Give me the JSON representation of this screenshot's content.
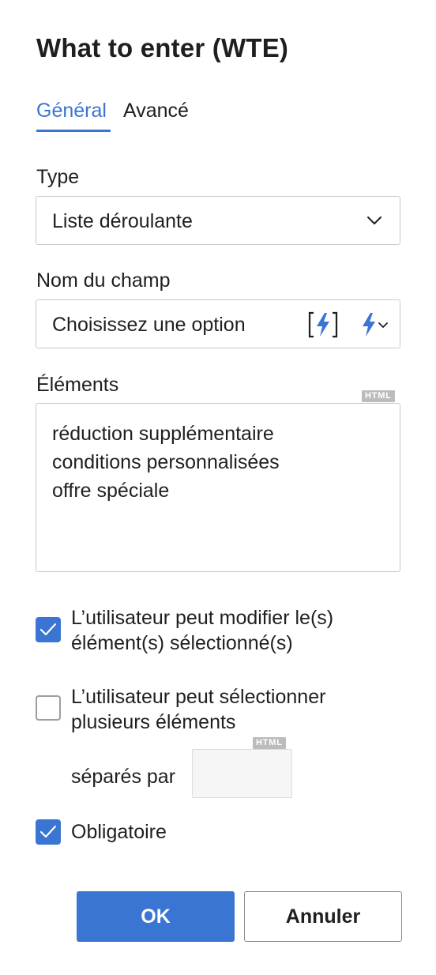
{
  "dialog": {
    "title": "What to enter (WTE)"
  },
  "tabs": [
    {
      "label": "Général",
      "active": true
    },
    {
      "label": "Avancé",
      "active": false
    }
  ],
  "type_field": {
    "label": "Type",
    "value": "Liste déroulante"
  },
  "field_name": {
    "label": "Nom du champ",
    "value": "Choisissez une option"
  },
  "elements": {
    "label": "Éléments",
    "badge": "HTML",
    "lines": [
      "réduction supplémentaire",
      "conditions personnalisées",
      "offre spéciale"
    ]
  },
  "options": {
    "can_edit": {
      "label_line1": "L’utilisateur peut modifier le(s)",
      "label_line2": "élément(s) sélectionné(s)",
      "checked": true
    },
    "multi_select": {
      "label_line1": "L’utilisateur peut sélectionner",
      "label_line2": "plusieurs éléments",
      "checked": false
    },
    "separator": {
      "label": "séparés par",
      "value": "",
      "badge": "HTML"
    },
    "required": {
      "label": "Obligatoire",
      "checked": true
    }
  },
  "buttons": {
    "ok": "OK",
    "cancel": "Annuler"
  },
  "colors": {
    "accent": "#3a75d4",
    "border": "#c9c9c9",
    "badge": "#bcbcbc"
  },
  "icons": [
    "chevron-down-icon",
    "bracketed-lightning-icon",
    "lightning-dropdown-icon",
    "checkmark-icon"
  ]
}
